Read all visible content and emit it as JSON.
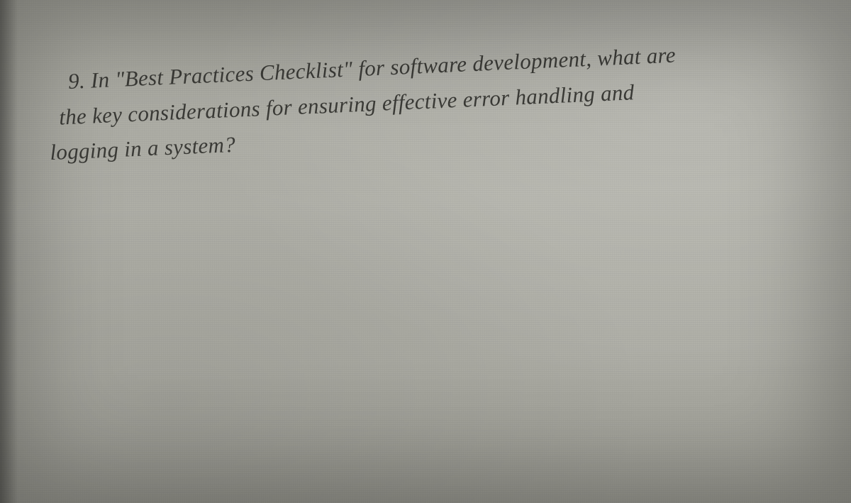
{
  "question": {
    "number": "9.",
    "line1": "9. In \"Best Practices Checklist\" for software development, what are",
    "line2": "the key considerations for ensuring effective error handling and",
    "line3": "logging in a system?"
  }
}
